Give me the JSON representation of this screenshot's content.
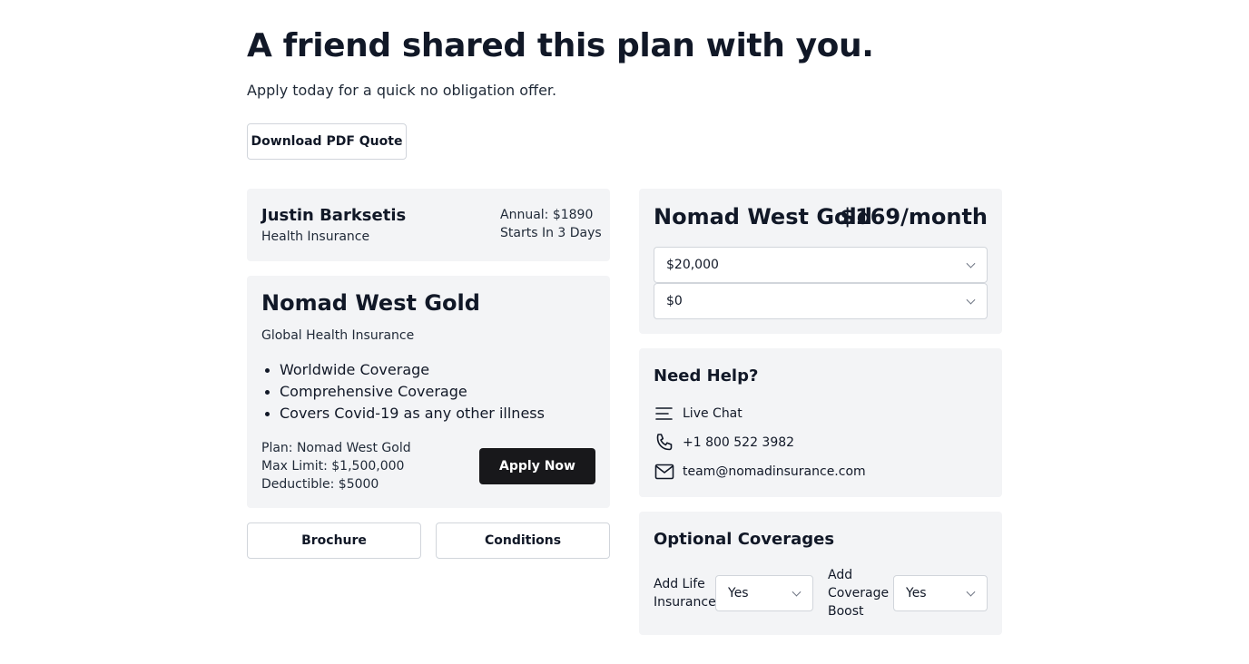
{
  "header": {
    "title": "A friend shared this plan with you.",
    "subtitle": "Apply today for a quick no obligation offer.",
    "download_label": "Download PDF Quote"
  },
  "person": {
    "name": "Justin Barksetis",
    "type": "Health Insurance",
    "annual": "Annual: $1890",
    "starts": "Starts In 3 Days"
  },
  "plan": {
    "name": "Nomad West Gold",
    "type": "Global Health Insurance",
    "features": [
      "Worldwide Coverage",
      "Comprehensive Coverage",
      "Covers Covid-19 as any other illness"
    ],
    "meta": {
      "plan": "Plan: Nomad West Gold",
      "max_limit": "Max Limit: $1,500,000",
      "deductible": "Deductible: $5000"
    },
    "apply_label": "Apply Now"
  },
  "links": {
    "brochure": "Brochure",
    "conditions": "Conditions"
  },
  "pricing": {
    "plan_name": "Nomad West Gold",
    "price": "$169/month",
    "limit_value": "$20,000",
    "deductible_value": "$0"
  },
  "help": {
    "title": "Need Help?",
    "chat": "Live Chat",
    "phone": "+1 800 522 3982",
    "email": "team@nomadinsurance.com",
    "icons": [
      "menu-lines-icon",
      "phone-icon",
      "envelope-icon"
    ]
  },
  "optional": {
    "title": "Optional Coverages",
    "life_label": "Add Life Insurance",
    "life_value": "Yes",
    "boost_label": "Add Coverage Boost",
    "boost_value": "Yes"
  },
  "colors": {
    "card_bg": "#f3f4f6",
    "primary_button": "#18181b",
    "text": "#111827",
    "border": "#d1d5db"
  }
}
